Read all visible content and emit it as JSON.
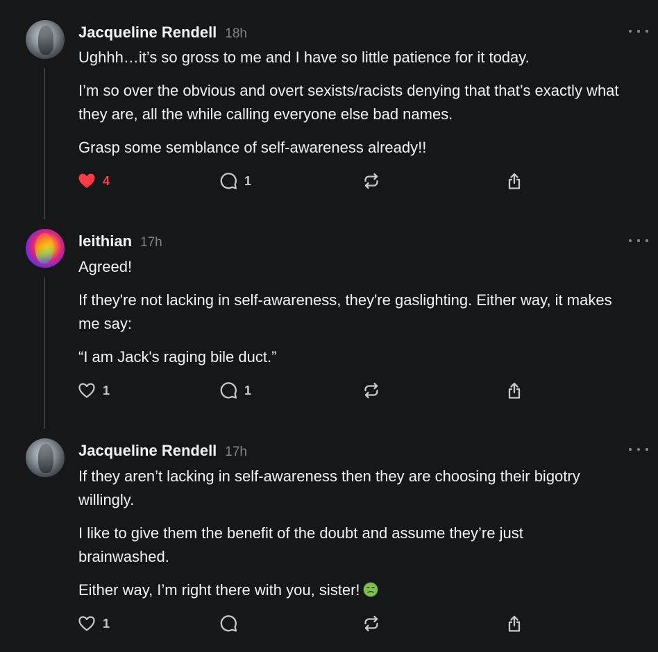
{
  "posts": [
    {
      "author": "Jacqueline Rendell",
      "time": "18h",
      "paragraphs": [
        "Ughhh…it’s so gross to me and I have so little patience for it today.",
        "I’m so over the obvious and overt sexists/racists denying that that’s exactly what they are, all the while calling everyone else bad names.",
        "Grasp some semblance of self-awareness already!!"
      ],
      "likes": "4",
      "liked": true,
      "replies": "1"
    },
    {
      "author": "leithian",
      "time": "17h",
      "paragraphs": [
        "Agreed!",
        "If they're not lacking in self-awareness, they're gaslighting. Either way, it makes me say:",
        "“I am Jack's raging bile duct.”"
      ],
      "likes": "1",
      "liked": false,
      "replies": "1"
    },
    {
      "author": "Jacqueline Rendell",
      "time": "17h",
      "paragraphs": [
        "If they aren’t lacking in self-awareness then they are choosing their bigotry willingly.",
        "I like to give them the benefit of the doubt and assume they’re just brainwashed.",
        "Either way, I’m right there with you, sister!"
      ],
      "emoji": "nauseated-face",
      "likes": "1",
      "liked": false,
      "replies": ""
    }
  ],
  "icons": {
    "like": "heart-icon",
    "reply": "comment-bubble-icon",
    "repost": "repost-icon",
    "share": "share-icon",
    "more": "more-dots-icon"
  },
  "colors": {
    "background": "#161718",
    "liked": "#ff3a47",
    "text": "#f1f3f5",
    "muted": "#7f848a",
    "thread_line": "#3a3c3f",
    "emoji": "#7fc24a"
  }
}
